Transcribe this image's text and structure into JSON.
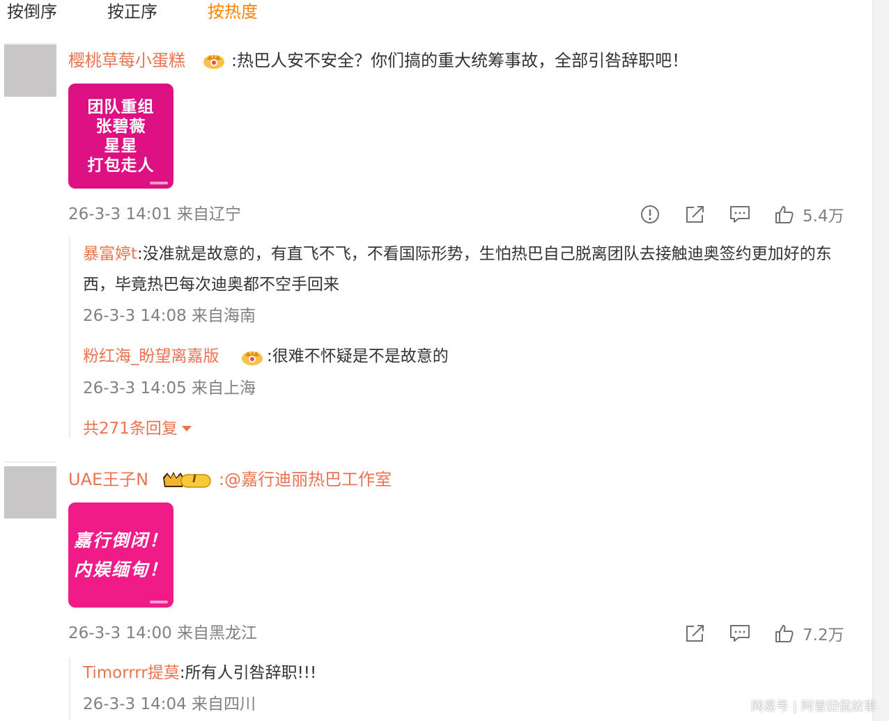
{
  "sort_tabs": [
    "按倒序",
    "按正序",
    "按热度"
  ],
  "comments": [
    {
      "username": "樱桃草莓小蛋糕",
      "text": ":热巴人安不安全？你们搞的重大统筹事故，全部引咎辞职吧！",
      "image_lines": [
        "团队重组",
        "张碧薇",
        "星星",
        "打包走人"
      ],
      "meta": "26-3-3 14:01 来自辽宁",
      "likes": "5.4万",
      "replies": [
        {
          "username": "暴富婷t",
          "text": ":没准就是故意的，有直飞不飞，不看国际形势，生怕热巴自己脱离团队去接触迪奥签约更加好的东西，毕竟热巴每次迪奥都不空手回来",
          "meta": "26-3-3 14:08 来自海南"
        },
        {
          "username": "粉红海_盼望离嘉版",
          "text": ":很难不怀疑是不是故意的",
          "meta": "26-3-3 14:05 来自上海"
        }
      ],
      "more_replies": "共271条回复"
    },
    {
      "username": "UAE王子N",
      "level": "I",
      "text": ":@嘉行迪丽热巴工作室",
      "image_lines": [
        "嘉行倒闭！",
        "内娱缅甸！"
      ],
      "meta": "26-3-3 14:00 来自黑龙江",
      "likes": "7.2万",
      "replies": [
        {
          "username": "Timorrrr提莫",
          "text": ":所有人引咎辞职!!!",
          "meta": "26-3-3 14:04 来自四川"
        }
      ]
    }
  ],
  "watermark": {
    "brand": "网易号",
    "account": "阿曾田侃故事"
  },
  "colors": {
    "username": "#eb7350",
    "active_tab": "#ff8200",
    "meta": "#808080",
    "image1_bg": "#dd1181",
    "image2_bg": "#f01b86"
  }
}
